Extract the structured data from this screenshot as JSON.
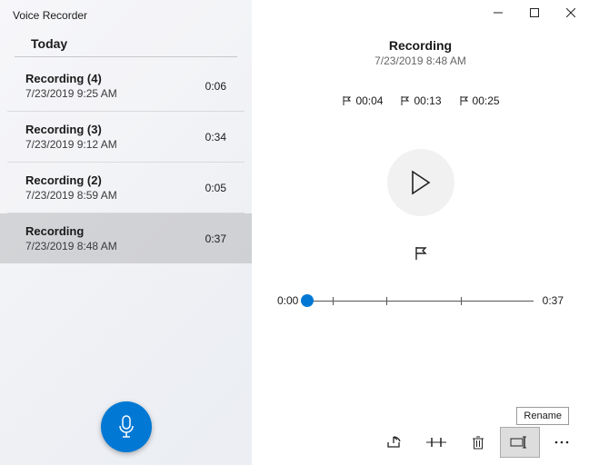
{
  "app_title": "Voice Recorder",
  "group": "Today",
  "recordings": [
    {
      "name": "Recording (4)",
      "date": "7/23/2019 9:25 AM",
      "length": "0:06"
    },
    {
      "name": "Recording (3)",
      "date": "7/23/2019 9:12 AM",
      "length": "0:34"
    },
    {
      "name": "Recording (2)",
      "date": "7/23/2019 8:59 AM",
      "length": "0:05"
    },
    {
      "name": "Recording",
      "date": "7/23/2019 8:48 AM",
      "length": "0:37"
    }
  ],
  "selected_index": 3,
  "detail": {
    "title": "Recording",
    "date": "7/23/2019 8:48 AM",
    "markers": [
      "00:04",
      "00:13",
      "00:25"
    ],
    "pos": "0:00",
    "total": "0:37"
  },
  "tooltip": "Rename",
  "colors": {
    "accent": "#0078D4"
  }
}
